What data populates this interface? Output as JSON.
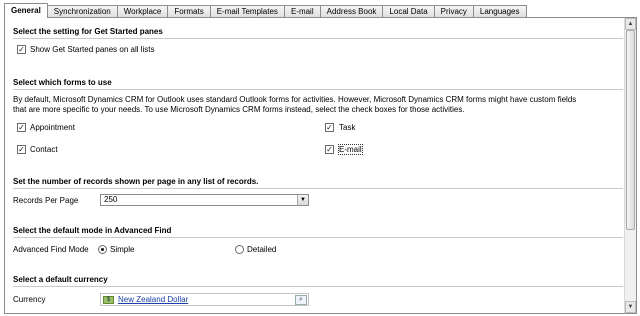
{
  "tabs": [
    {
      "label": "General",
      "active": true
    },
    {
      "label": "Synchronization"
    },
    {
      "label": "Workplace"
    },
    {
      "label": "Formats"
    },
    {
      "label": "E-mail Templates"
    },
    {
      "label": "E-mail"
    },
    {
      "label": "Address Book"
    },
    {
      "label": "Local Data"
    },
    {
      "label": "Privacy"
    },
    {
      "label": "Languages"
    }
  ],
  "get_started": {
    "heading": "Select the setting for Get Started panes",
    "checkbox_label": "Show Get Started panes on all lists",
    "checked": true
  },
  "forms": {
    "heading": "Select which forms to use",
    "description_line1": "By default, Microsoft Dynamics CRM for Outlook uses standard Outlook forms for activities. However, Microsoft Dynamics CRM forms might have custom fields",
    "description_line2": "that are more specific to your needs. To use Microsoft Dynamics CRM forms instead, select the check boxes for those activities.",
    "appointment_label": "Appointment",
    "task_label": "Task",
    "contact_label": "Contact",
    "email_label": "E-mail",
    "appointment_checked": true,
    "task_checked": true,
    "contact_checked": true,
    "email_checked": true
  },
  "records": {
    "heading": "Set the number of records shown per page in any list of records.",
    "label": "Records Per Page",
    "value": "250"
  },
  "advanced_find": {
    "heading": "Select the default mode in Advanced Find",
    "label": "Advanced Find Mode",
    "simple_label": "Simple",
    "detailed_label": "Detailed",
    "selected": "Simple"
  },
  "currency": {
    "heading": "Select a default currency",
    "label": "Currency",
    "value": "New Zealand Dollar"
  },
  "icons": {
    "check": "check-icon",
    "dropdown": "chevron-down-icon",
    "currency": "currency-icon",
    "lookup": "lookup-search-icon",
    "scroll_up": "scroll-up-icon",
    "scroll_down": "scroll-down-icon"
  }
}
